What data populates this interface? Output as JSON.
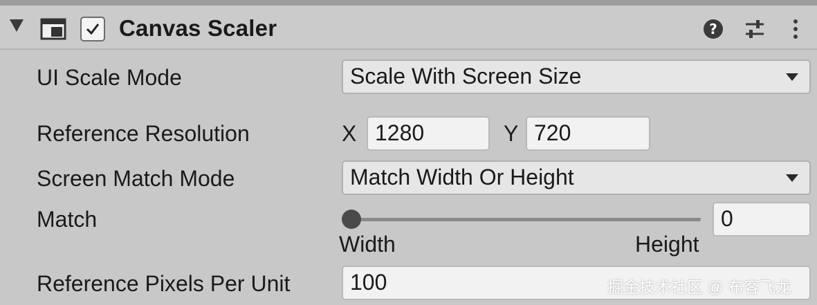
{
  "component": {
    "title": "Canvas Scaler",
    "enabled": true,
    "icons": [
      "foldout-arrow-icon",
      "canvas-scaler-icon",
      "checkbox-icon",
      "help-icon",
      "preset-icon",
      "more-menu-icon"
    ]
  },
  "fields": {
    "ui_scale_mode": {
      "label": "UI Scale Mode",
      "value": "Scale With Screen Size"
    },
    "reference_resolution": {
      "label": "Reference Resolution",
      "x_label": "X",
      "x_value": "1280",
      "y_label": "Y",
      "y_value": "720"
    },
    "screen_match_mode": {
      "label": "Screen Match Mode",
      "value": "Match Width Or Height"
    },
    "match": {
      "label": "Match",
      "value": "0",
      "min_label": "Width",
      "max_label": "Height",
      "fraction": 0
    },
    "reference_pixels_per_unit": {
      "label": "Reference Pixels Per Unit",
      "value": "100"
    }
  },
  "watermark": "掘金技术社区 @ 布客飞龙",
  "colors": {
    "background": "#c8c8c8",
    "field": "#f2f2f2",
    "text": "#1a1a1a"
  }
}
